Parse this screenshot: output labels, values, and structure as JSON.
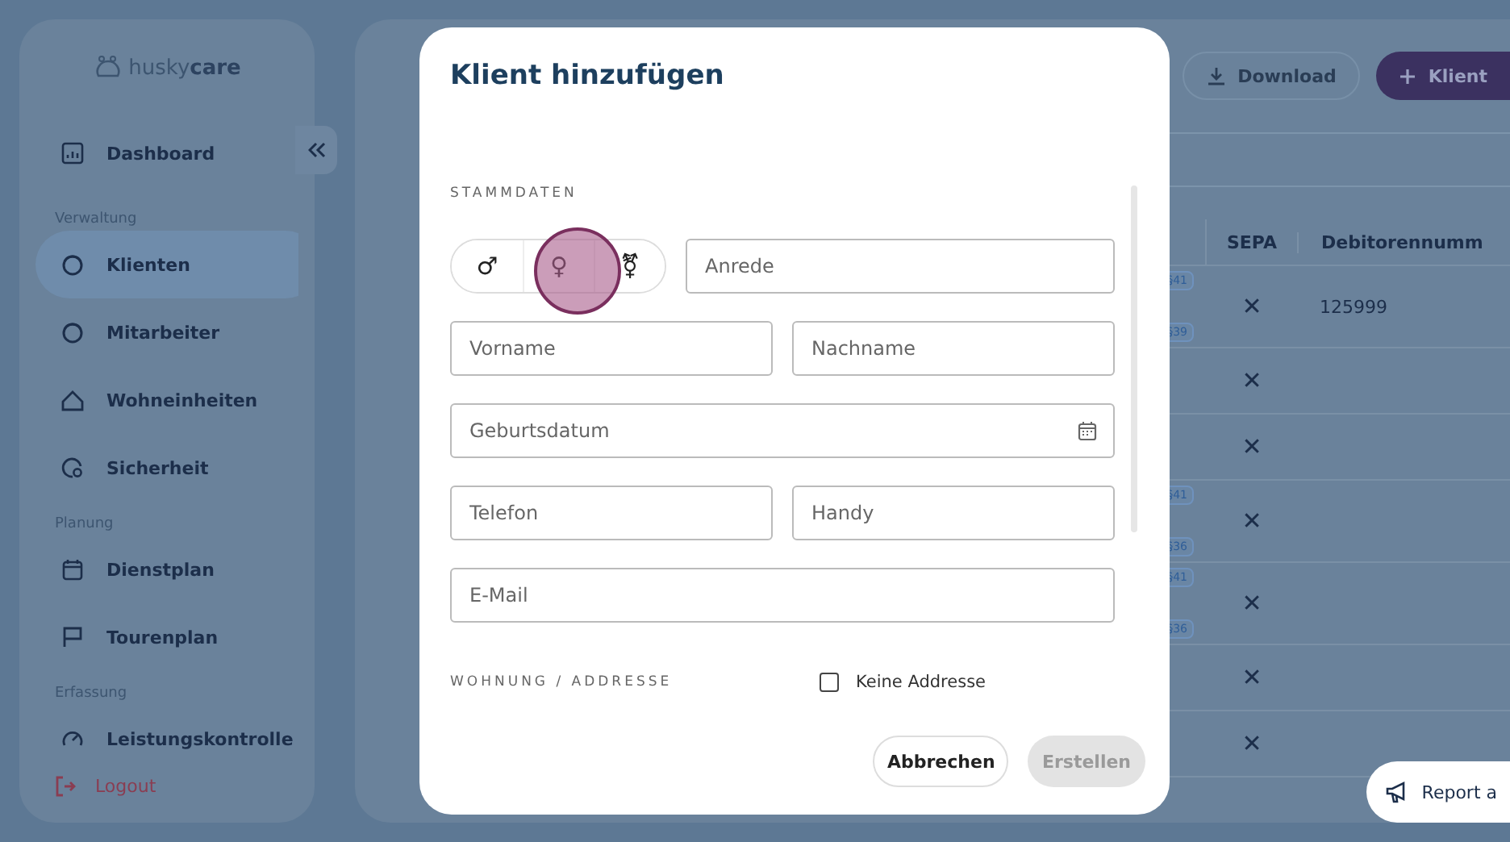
{
  "sidebar": {
    "logo": {
      "light": "husky",
      "bold": "care"
    },
    "nav": [
      {
        "kind": "item",
        "label": "Dashboard",
        "selected": false
      },
      {
        "kind": "section",
        "label": "Verwaltung"
      },
      {
        "kind": "item",
        "label": "Klienten",
        "selected": true
      },
      {
        "kind": "item",
        "label": "Mitarbeiter",
        "selected": false
      },
      {
        "kind": "item",
        "label": "Wohneinheiten",
        "selected": false
      },
      {
        "kind": "item",
        "label": "Sicherheit",
        "selected": false
      },
      {
        "kind": "section",
        "label": "Planung"
      },
      {
        "kind": "item",
        "label": "Dienstplan",
        "selected": false
      },
      {
        "kind": "item",
        "label": "Tourenplan",
        "selected": false
      },
      {
        "kind": "section",
        "label": "Erfassung"
      },
      {
        "kind": "item",
        "label": "Leistungskontrolle",
        "selected": false
      }
    ],
    "logout": "Logout"
  },
  "main": {
    "download": "Download",
    "add": "Klient",
    "columns": [
      "SEPA",
      "Debitorennumm"
    ],
    "rows": [
      {
        "badges": [
          "§41",
          "§39"
        ],
        "sepa": "✕",
        "debitor": "125999"
      },
      {
        "badges": [],
        "sepa": "✕",
        "debitor": ""
      },
      {
        "badges": [],
        "sepa": "✕",
        "debitor": ""
      },
      {
        "badges": [
          "§41",
          "§36"
        ],
        "sepa": "✕",
        "debitor": ""
      },
      {
        "badges": [
          "§41",
          "§36"
        ],
        "sepa": "✕",
        "debitor": ""
      },
      {
        "badges": [],
        "sepa": "✕",
        "debitor": ""
      },
      {
        "badges": [],
        "sepa": "✕",
        "debitor": ""
      }
    ],
    "report": "Report a"
  },
  "modal": {
    "title": "Klient hinzufügen",
    "section_1": "STAMMDATEN",
    "genders": [
      {
        "symbol": "♂",
        "selected": false
      },
      {
        "symbol": "♀",
        "selected": false
      },
      {
        "symbol": "⚧",
        "selected": false
      }
    ],
    "anrede": {
      "placeholder": "Anrede"
    },
    "rows": [
      [
        {
          "placeholder": "Vorname"
        },
        {
          "placeholder": "Nachname"
        }
      ],
      [
        {
          "placeholder": "Geburtsdatum",
          "kind": "date"
        }
      ],
      [
        {
          "placeholder": "Telefon"
        },
        {
          "placeholder": "Handy"
        }
      ],
      [
        {
          "placeholder": "E-Mail"
        }
      ]
    ],
    "section_2": "WOHNUNG / ADDRESSE",
    "no_address": {
      "label": "Keine Addresse",
      "checked": false
    },
    "cancel": "Abbrechen",
    "create": {
      "label": "Erstellen",
      "disabled": true
    }
  }
}
